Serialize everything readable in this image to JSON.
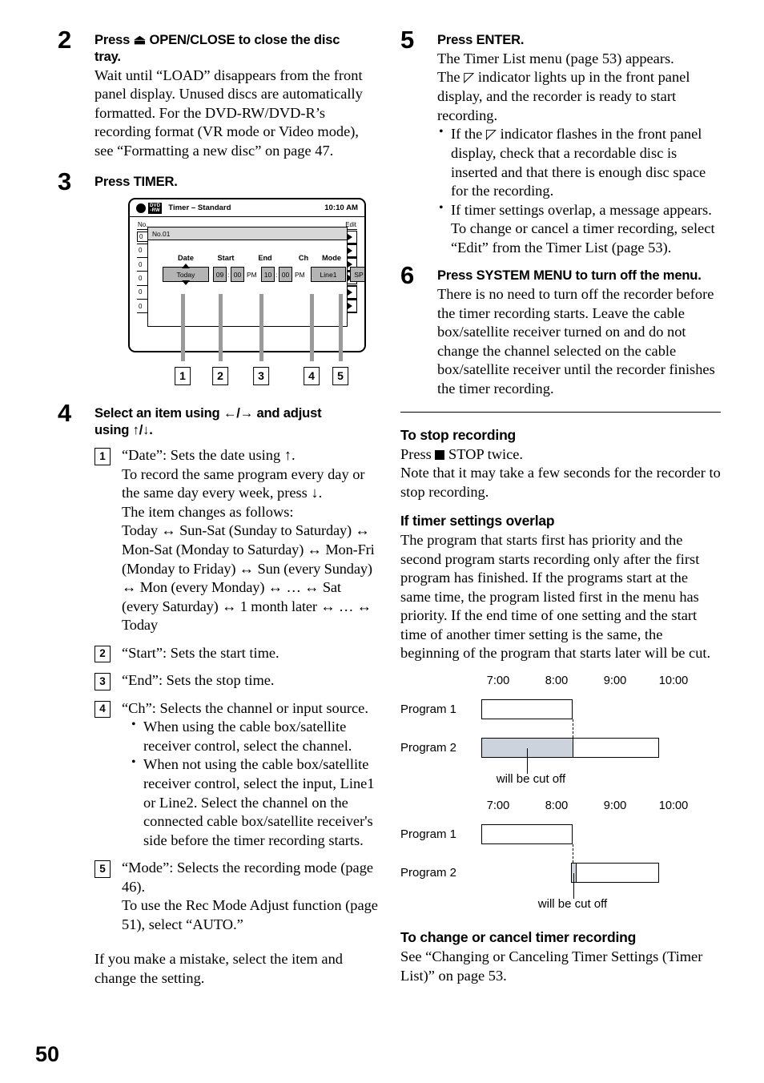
{
  "page_number": "50",
  "left_column": {
    "step2": {
      "number": "2",
      "title_line1": "Press ⏏ OPEN/CLOSE to close the disc",
      "title_line2": "tray.",
      "body": "Wait until “LOAD” disappears from the front panel display. Unused discs are automatically formatted. For the DVD-RW/DVD-R’s recording format (VR mode or Video mode), see “Formatting a new disc” on page 47."
    },
    "step3": {
      "number": "3",
      "title": "Press TIMER."
    },
    "tv_screen": {
      "title": "Timer – Standard",
      "clock": "10:10 AM",
      "disc_badge_line1": "DVD",
      "disc_badge_line2": "-RW",
      "list_header_no": "No.",
      "list_header_edit": "Edit",
      "list_rows": [
        "0",
        "0",
        "0",
        "0",
        "0",
        "0"
      ],
      "dialog": {
        "header": "No.01",
        "labels": [
          "Date",
          "Start",
          "End",
          "Ch",
          "Mode"
        ],
        "date_value": "Today",
        "start_hour": "09",
        "start_min": "00",
        "start_ampm": "PM",
        "end_hour": "10",
        "end_min": "00",
        "end_ampm": "PM",
        "ch_value": "Line1",
        "mode_value": "SP",
        "time_separator": ":"
      },
      "callouts": [
        "1",
        "2",
        "3",
        "4",
        "5"
      ]
    },
    "step4": {
      "number": "4",
      "title_line1": "Select an item using ←/→ and adjust",
      "title_line2": "using ↑/↓.",
      "items": [
        {
          "num": "1",
          "lines": [
            "“Date”: Sets the date using ↑.",
            "To record the same program every day or the same day every week, press ↓.",
            "The item changes as follows:",
            "Today ↔ Sun-Sat (Sunday to Saturday) ↔ Mon-Sat (Monday to Saturday) ↔ Mon-Fri (Monday to Friday) ↔ Sun (every Sunday) ↔ Mon (every Monday) ↔ … ↔ Sat (every Saturday) ↔ 1 month later ↔ … ↔ Today"
          ]
        },
        {
          "num": "2",
          "lines": [
            "“Start”: Sets the start time."
          ]
        },
        {
          "num": "3",
          "lines": [
            "“End”: Sets the stop time."
          ]
        },
        {
          "num": "4",
          "lines": [
            "“Ch”: Selects the channel or input source."
          ],
          "bullets": [
            "When using the cable box/satellite receiver control, select the channel.",
            "When not using the cable box/satellite receiver control, select the input, Line1 or Line2. Select the channel on the connected cable box/satellite receiver's side before the timer recording starts."
          ]
        },
        {
          "num": "5",
          "lines": [
            "“Mode”: Selects the recording mode (page 46).",
            "To use the Rec Mode Adjust function (page 51), select “AUTO.”"
          ]
        }
      ],
      "closing": "If you make a mistake, select the item and change the setting."
    }
  },
  "right_column": {
    "step5": {
      "number": "5",
      "title": "Press ENTER.",
      "body_line1": "The Timer List menu (page 53) appears.",
      "body_line2_a": "The ",
      "body_line2_b": " indicator lights up in the front panel display, and the recorder is ready to start recording.",
      "bullets": [
        {
          "a": "If the ",
          "b": " indicator flashes in the front panel display, check that a recordable disc is inserted and that there is enough disc space for the recording."
        },
        {
          "a": "If timer settings overlap, a message appears. To change or cancel a timer recording, select “Edit” from the Timer List (page 53).",
          "b": ""
        }
      ]
    },
    "step6": {
      "number": "6",
      "title": "Press SYSTEM MENU to turn off the menu.",
      "body": "There is no need to turn off the recorder before the timer recording starts. Leave the cable box/satellite receiver turned on and do not change the channel selected on the cable box/satellite receiver until the recorder finishes the timer recording."
    },
    "stop_recording": {
      "heading": "To stop recording",
      "line1_a": "Press ",
      "line1_b": " STOP twice.",
      "line2": "Note that it may take a few seconds for the recorder to stop recording."
    },
    "overlap": {
      "heading": "If timer settings overlap",
      "body": "The program that starts first has priority and the second program starts recording only after the first program has finished. If the programs start at the same time, the program listed first in the menu has priority. If the end time of one setting and the start time of another timer setting is the same, the beginning of the program that starts later will be cut."
    },
    "diagrams": [
      {
        "ticks": [
          "7:00",
          "8:00",
          "9:00",
          "10:00"
        ],
        "row1_label": "Program 1",
        "row2_label": "Program 2",
        "cut_label": "will be cut off",
        "program1": {
          "start": "7:00",
          "end": "8:30"
        },
        "program2": {
          "start": "7:00",
          "end": "9:30",
          "cut_start": "7:00",
          "cut_end": "8:30"
        }
      },
      {
        "ticks": [
          "7:00",
          "8:00",
          "9:00",
          "10:00"
        ],
        "row1_label": "Program 1",
        "row2_label": "Program 2",
        "cut_label": "will be cut off",
        "program1": {
          "start": "7:00",
          "end": "8:30"
        },
        "program2": {
          "start": "8:30",
          "end": "10:00",
          "cut_start": "8:30",
          "cut_end": "8:35"
        }
      }
    ],
    "change_cancel": {
      "heading": "To change or cancel timer recording",
      "body": "See “Changing or Canceling Timer Settings (Timer List)”  on page 53."
    }
  },
  "colors": {
    "field_gray": "#b4b4b4",
    "dialog_head_gray": "#d7d7d7",
    "leader_gray": "#9a9a9a",
    "shaded_bar": "#ccd3dd"
  }
}
